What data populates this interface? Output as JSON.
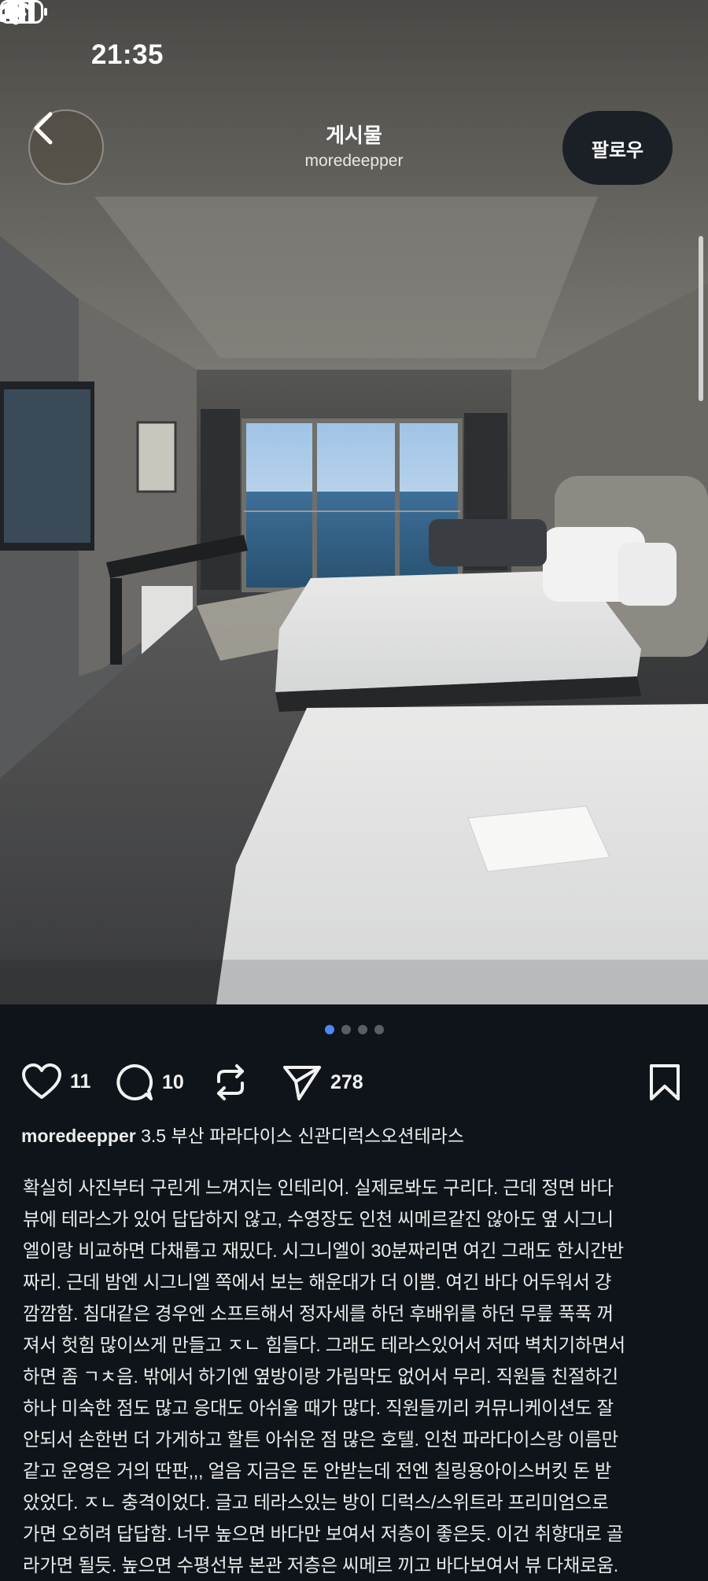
{
  "status_bar": {
    "time": "21:35"
  },
  "header": {
    "title": "게시물",
    "username": "moredeepper",
    "follow_label": "팔로우"
  },
  "carousel": {
    "page_count": 4,
    "active_index": 0
  },
  "actions": {
    "likes": "11",
    "comments": "10",
    "shares": "278"
  },
  "post": {
    "author": "moredeepper",
    "headline": "3.5 부산 파라다이스 신관디럭스오션테라스",
    "body_lines": [
      " 확실히 사진부터 구린게 느껴지는 인테리어. 실제로봐도 구리다. 근데 정면 바다",
      "뷰에 테라스가 있어 답답하지 않고, 수영장도 인천 씨메르같진 않아도 옆 시그니",
      "엘이랑 비교하면 다채롭고 재밌다. 시그니엘이 30분짜리면 여긴 그래도 한시간반",
      "짜리. 근데 밤엔 시그니엘 쪽에서 보는 해운대가 더 이쁨. 여긴 바다 어두워서 걍",
      "깜깜함. 침대같은 경우엔 소프트해서 정자세를 하던 후배위를 하던 무릎 푹푹 꺼",
      "져서 헛힘 많이쓰게 만들고 ㅈㄴ 힘들다. 그래도 테라스있어서 저따 벽치기하면서",
      "하면 좀 ㄱㅊ음. 밖에서 하기엔 옆방이랑 가림막도 없어서 무리. 직원들 친절하긴",
      "하나 미숙한 점도 많고 응대도 아쉬울 때가 많다. 직원들끼리 커뮤니케이션도 잘",
      "안되서 손한번 더 가게하고 할튼 아쉬운 점 많은 호텔. 인천 파라다이스랑 이름만",
      "같고 운영은 거의 딴판,,, 얼음 지금은 돈 안받는데 전엔 칠링용아이스버킷 돈 받",
      "았었다. ㅈㄴ 충격이었다. 글고 테라스있는 방이 디럭스/스위트라 프리미엄으로",
      "가면 오히려 답답함. 너무 높으면 바다만 보여서 저층이 좋은듯. 이건 취향대로 골",
      "라가면 될듯. 높으면 수평선뷰 본관 저층은 씨메르 끼고 바다보여서 뷰 다채로움."
    ]
  },
  "colors": {
    "background": "#0f141a",
    "active_dot": "#4e88f5",
    "inactive_dot": "#585e66"
  }
}
